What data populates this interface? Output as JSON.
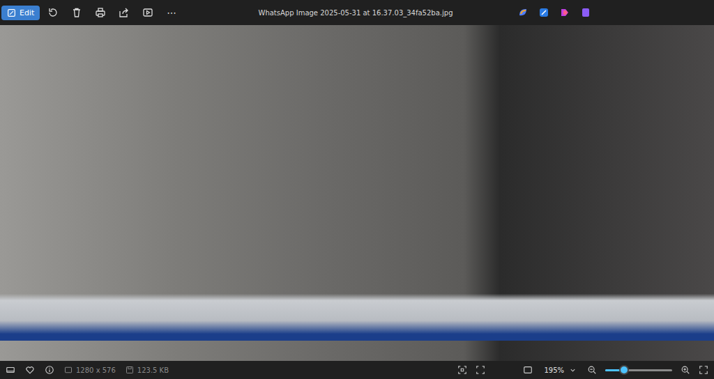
{
  "window": {
    "title": "WhatsApp Image 2025-05-31 at 16.37.03_34fa52ba.jpg"
  },
  "toolbar": {
    "edit": {
      "label": "Edit",
      "selected": true
    },
    "more": "⋯"
  },
  "status_bar": {
    "favorite": false,
    "dimensions": "1280 x 576",
    "file_size": "123.5 KB",
    "zoom": "195%",
    "zoom_level": 0.28
  }
}
